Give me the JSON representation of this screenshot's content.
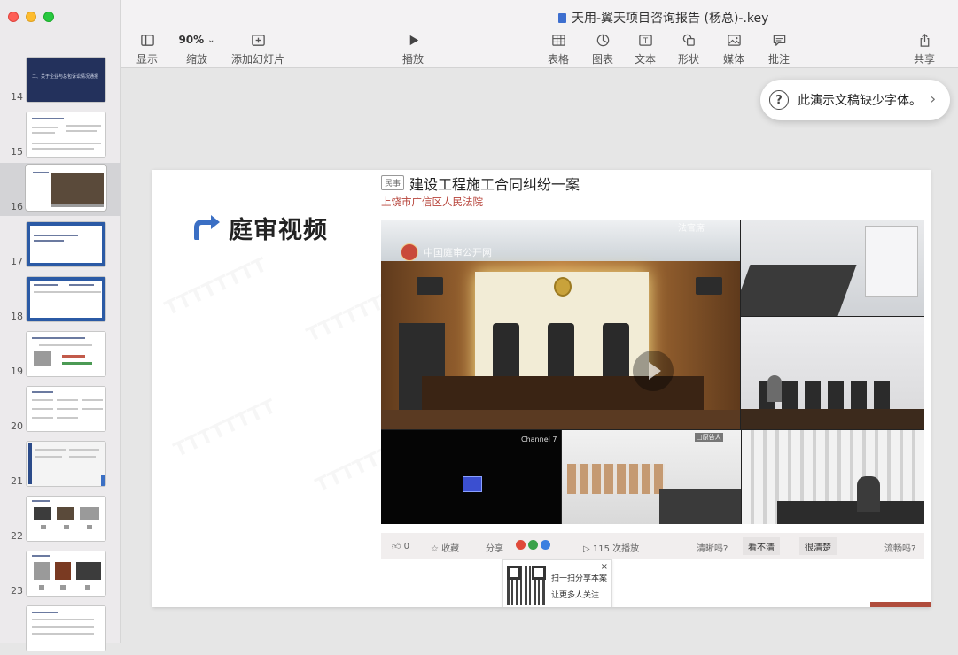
{
  "window": {
    "title": "天用-翼天项目咨询报告 (杨总)-.key"
  },
  "toolbar": {
    "view_label": "显示",
    "zoom_value": "90%",
    "zoom_label": "缩放",
    "add_slide_label": "添加幻灯片",
    "play_label": "播放",
    "table_label": "表格",
    "chart_label": "图表",
    "text_label": "文本",
    "shape_label": "形状",
    "media_label": "媒体",
    "comment_label": "批注",
    "share_label": "共享"
  },
  "sidebar": {
    "slides": [
      {
        "number": "14",
        "thumb_title": "二、关于企业与总包诉讼情况通报"
      },
      {
        "number": "15"
      },
      {
        "number": "16",
        "selected": true
      },
      {
        "number": "17"
      },
      {
        "number": "18"
      },
      {
        "number": "19"
      },
      {
        "number": "20"
      },
      {
        "number": "21"
      },
      {
        "number": "22"
      },
      {
        "number": "23"
      },
      {
        "number": ""
      }
    ]
  },
  "font_warning": {
    "text": "此演示文稿缺少字体。",
    "icon": "question-circle-icon"
  },
  "slide": {
    "heading": "庭审视频",
    "case_tag": "民事",
    "case_title": "建设工程施工合同纠纷一案",
    "court": "上饶市广信区人民法院",
    "video": {
      "brand": "中国庭审公开网",
      "center_label": "法官席",
      "channel_label": "Channel 7",
      "cell_label": "□原告人"
    },
    "bar": {
      "likes": "0",
      "favorite": "收藏",
      "share": "分享",
      "play_count": "115",
      "play_suffix": "次播放",
      "clarity_q": "清晰吗?",
      "unclear": "看不清",
      "clear": "很清楚",
      "smooth_q": "流畅吗?"
    },
    "qr": {
      "line1": "扫一扫分享本案",
      "line2": "让更多人关注",
      "close": "×"
    }
  },
  "colors": {
    "accent_blue": "#3b6fc4",
    "court_red": "#b7443b",
    "navy_thumb": "#23315c"
  }
}
